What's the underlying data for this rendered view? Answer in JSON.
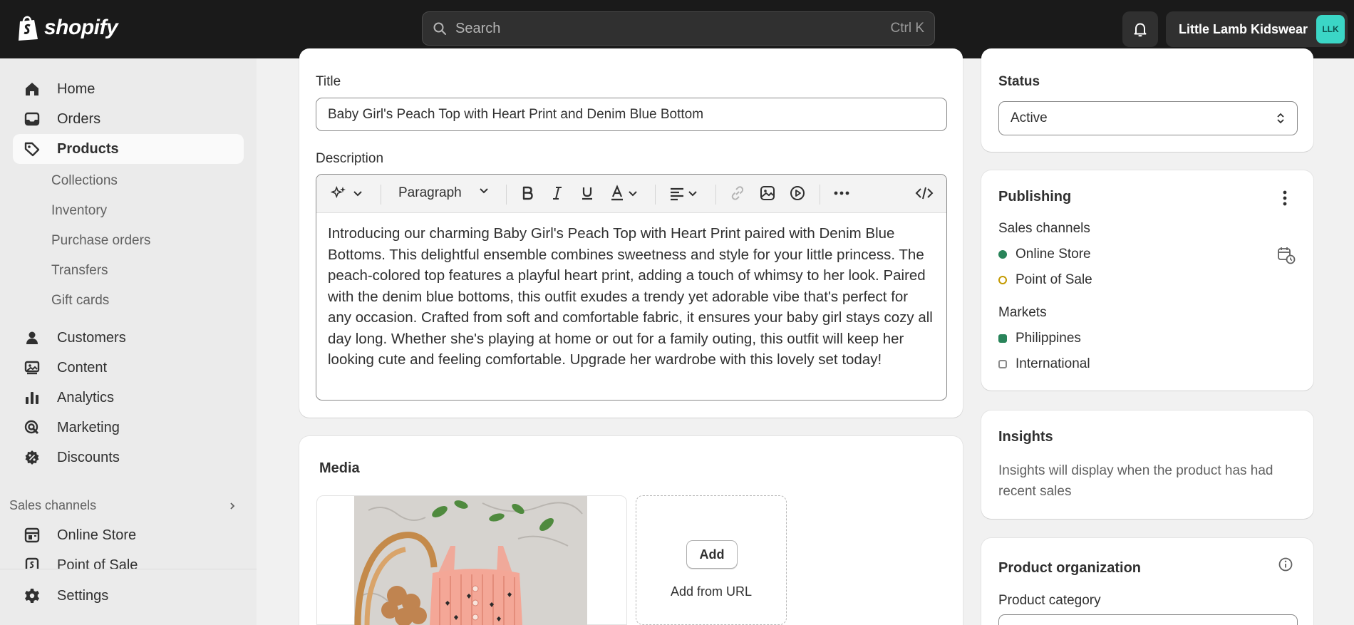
{
  "topbar": {
    "brand": "shopify",
    "search_placeholder": "Search",
    "search_shortcut": "Ctrl K",
    "store_name": "Little Lamb Kidswear",
    "avatar_initials": "LLK"
  },
  "sidebar": {
    "items": [
      {
        "label": "Home",
        "icon": "home-icon"
      },
      {
        "label": "Orders",
        "icon": "orders-icon"
      },
      {
        "label": "Products",
        "icon": "tag-icon",
        "active": true
      },
      {
        "label": "Customers",
        "icon": "person-icon"
      },
      {
        "label": "Content",
        "icon": "content-icon"
      },
      {
        "label": "Analytics",
        "icon": "bar-chart-icon"
      },
      {
        "label": "Marketing",
        "icon": "target-icon"
      },
      {
        "label": "Discounts",
        "icon": "discount-icon"
      }
    ],
    "product_subitems": [
      "Collections",
      "Inventory",
      "Purchase orders",
      "Transfers",
      "Gift cards"
    ],
    "sales_channels_heading": "Sales channels",
    "channels": [
      "Online Store",
      "Point of Sale"
    ],
    "settings_label": "Settings"
  },
  "product": {
    "title_label": "Title",
    "title_value": "Baby Girl's Peach Top with Heart Print and Denim Blue Bottom",
    "description_label": "Description",
    "paragraph_style": "Paragraph",
    "description": "Introducing our charming Baby Girl's Peach Top with Heart Print paired with Denim Blue Bottoms. This delightful ensemble combines sweetness and style for your little princess. The peach-colored top features a playful heart print, adding a touch of whimsy to her look. Paired with the denim blue bottoms, this outfit exudes a trendy yet adorable vibe that's perfect for any occasion. Crafted from soft and comfortable fabric, it ensures your baby girl stays cozy all day long. Whether she's playing at home or out for a family outing, this outfit will keep her looking cute and feeling comfortable. Upgrade her wardrobe with this lovely set today!"
  },
  "media": {
    "title": "Media",
    "add_label": "Add",
    "add_url_label": "Add from URL"
  },
  "status": {
    "label": "Status",
    "value": "Active"
  },
  "publishing": {
    "title": "Publishing",
    "sales_channels_label": "Sales channels",
    "channels": [
      {
        "name": "Online Store",
        "state": "active"
      },
      {
        "name": "Point of Sale",
        "state": "pending"
      }
    ],
    "markets_label": "Markets",
    "markets": [
      {
        "name": "Philippines",
        "state": "active"
      },
      {
        "name": "International",
        "state": "inactive"
      }
    ]
  },
  "insights": {
    "title": "Insights",
    "text": "Insights will display when the product has had recent sales"
  },
  "organization": {
    "title": "Product organization",
    "category_label": "Product category"
  },
  "colors": {
    "topbar": "#1a1a1a",
    "active_dot": "#29845a",
    "pending_dot": "#c49a00",
    "avatar": "#3bd6c6"
  }
}
